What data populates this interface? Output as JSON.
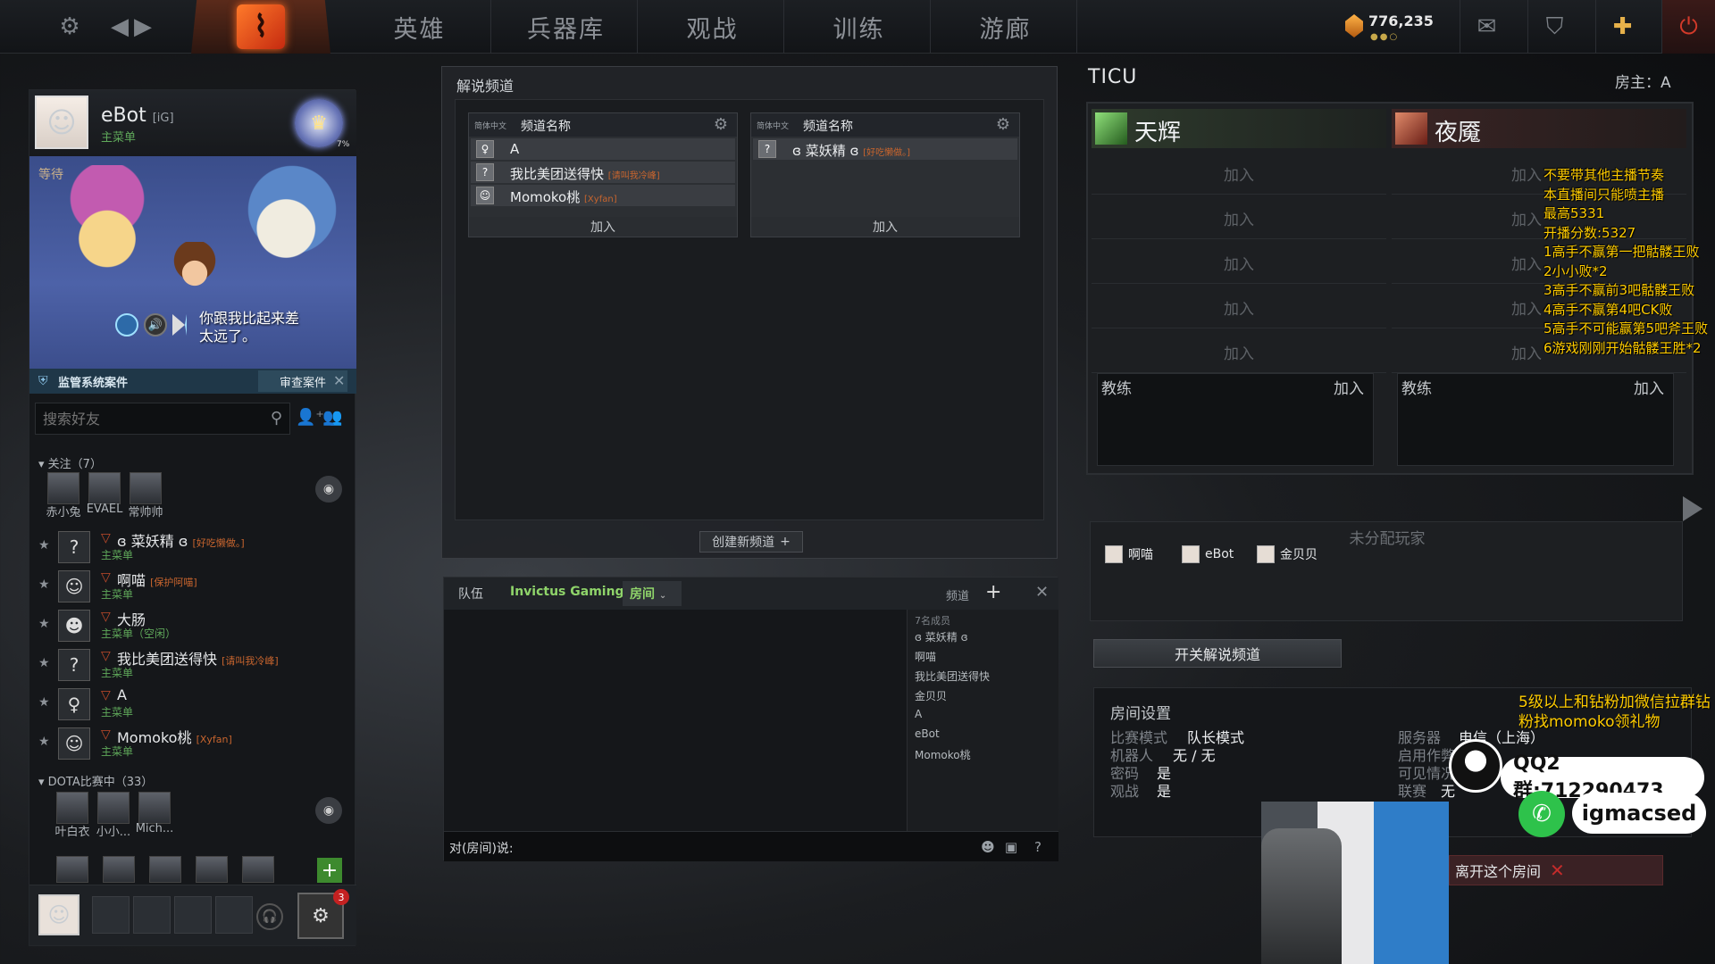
{
  "topbar": {
    "nav": [
      "英雄",
      "兵器库",
      "观战",
      "训练",
      "游廊"
    ],
    "currency": "776,235"
  },
  "profile": {
    "name": "eBot",
    "tag": "[iG]",
    "status": "主菜单",
    "rank_percent": "7%"
  },
  "banner": {
    "waiting": "等待",
    "speech": "你跟我比起来差太远了。"
  },
  "report": {
    "label": "监管系统案件",
    "button": "审查案件"
  },
  "friends": {
    "search_placeholder": "搜索好友",
    "follow_header": "关注（7）",
    "follow_avatars": [
      "赤小兔",
      "EVAEL",
      "常帅帅"
    ],
    "list": [
      {
        "name": "ɞ 菜妖精 ɞ",
        "tag": "[好吃懒做。]",
        "status": "主菜单"
      },
      {
        "name": "啊喵",
        "tag": "[保护阿喵]",
        "status": "主菜单"
      },
      {
        "name": "大肠",
        "tag": "",
        "status": "主菜单（空闲）"
      },
      {
        "name": "我比美团送得快",
        "tag": "[请叫我冷峰]",
        "status": "主菜单"
      },
      {
        "name": "A",
        "tag": "",
        "status": "主菜单"
      },
      {
        "name": "Momoko桃",
        "tag": "[Xyfan]",
        "status": "主菜单"
      }
    ],
    "dota_header": "DOTA比赛中（33）",
    "dota_avatars": [
      "叶白衣",
      "小小...",
      "Mich..."
    ]
  },
  "party": {
    "badge": "3"
  },
  "broadcast": {
    "title": "解说频道",
    "create_button": "创建新频道",
    "channels": [
      {
        "lang": "简体中文",
        "name": "频道名称",
        "members": [
          {
            "name": "A",
            "tag": ""
          },
          {
            "name": "我比美团送得快",
            "tag": "[请叫我冷峰]"
          },
          {
            "name": "Momoko桃",
            "tag": "[Xyfan]"
          }
        ],
        "join": "加入"
      },
      {
        "lang": "简体中文",
        "name": "频道名称",
        "members": [
          {
            "name": "ɞ 菜妖精 ɞ",
            "tag": "[好吃懒做。]"
          }
        ],
        "join": "加入"
      }
    ]
  },
  "chat": {
    "tabs": [
      "队伍",
      "Invictus Gaming",
      "房间"
    ],
    "channel_label": "频道",
    "member_count": "7名成员",
    "members": [
      "ɞ 菜妖精 ɞ",
      "啊喵",
      "我比美团送得快",
      "金贝贝",
      "A",
      "eBot",
      "Momoko桃"
    ],
    "prefix": "对(房间)说:"
  },
  "lobby": {
    "title": "TICU",
    "host": "房主：A",
    "radiant": "天辉",
    "dire": "夜魇",
    "join": "加入",
    "coach": "教练",
    "unassigned_title": "未分配玩家",
    "unassigned": [
      "啊喵",
      "eBot",
      "金贝贝"
    ],
    "toggle_broadcast": "开关解说频道",
    "leave": "离开这个房间"
  },
  "room_settings": {
    "title": "房间设置",
    "left": [
      {
        "k": "比赛模式",
        "v": "队长模式"
      },
      {
        "k": "机器人",
        "v": "无 / 无"
      },
      {
        "k": "密码",
        "v": "是"
      },
      {
        "k": "观战",
        "v": "是"
      }
    ],
    "right": [
      {
        "k": "服务器",
        "v": "电信（上海）"
      },
      {
        "k": "启用作弊",
        "v": ""
      },
      {
        "k": "可见情况",
        "v": ""
      },
      {
        "k": "联赛",
        "v": "无"
      }
    ]
  },
  "stream_overlay": {
    "rules": [
      "不要带其他主播节奏",
      "本直播间只能喷主播",
      "最高5331",
      "开播分数:5327",
      "1高手不赢第一把骷髅王败",
      "2小小败*2",
      "3高手不赢前3吧骷髅王败",
      "4高手不赢第4吧CK败",
      "5高手不可能赢第5吧斧王败",
      "6游戏刚刚开始骷髅王胜*2"
    ],
    "promo": "5级以上和钻粉加微信拉群钻粉找momoko领礼物",
    "qq": "QQ2群:712290473",
    "wechat": "igmacsed"
  },
  "colors": {
    "accent_green": "#8fd46a",
    "status_green": "#5fa85a",
    "overlay_yellow": "#ffcc00",
    "danger_red": "#c42b2b"
  }
}
